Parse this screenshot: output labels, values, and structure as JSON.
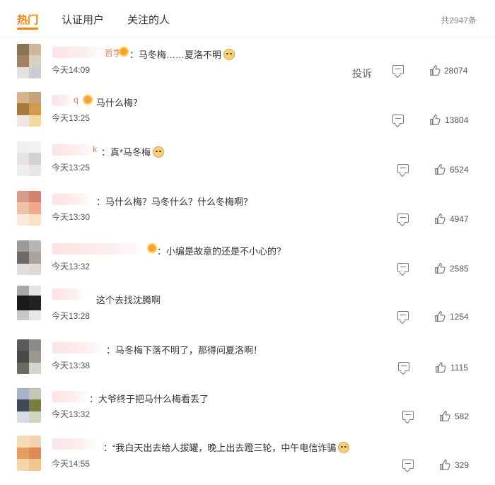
{
  "tabs": [
    "热门",
    "认证用户",
    "关注的人"
  ],
  "total": "共2947条",
  "report_label": "投诉",
  "colors": {
    "accent": "#ff8200",
    "text": "#333333",
    "muted": "#888888"
  },
  "comments": [
    {
      "text": "：马冬梅……夏洛不明",
      "time": "今天14:09",
      "likes": "28074",
      "name_visible": "哲学",
      "emoji": "dog-icon"
    },
    {
      "text": "马什么梅？",
      "time": "今天13:25",
      "likes": "13804",
      "name_visible": "q",
      "emoji": ""
    },
    {
      "text": "：真*马冬梅",
      "time": "今天13:25",
      "likes": "6524",
      "name_visible": "k",
      "emoji": "dog-icon"
    },
    {
      "text": "：马什么梅？马冬什么？什么冬梅啊？",
      "time": "今天13:30",
      "likes": "4947",
      "name_visible": "",
      "emoji": ""
    },
    {
      "text": "：小编是故意的还是不小心的？",
      "time": "今天13:32",
      "likes": "2585",
      "name_visible": "",
      "emoji": ""
    },
    {
      "text": "这个去找沈腾啊",
      "time": "今天13:28",
      "likes": "1254",
      "name_visible": "",
      "emoji": ""
    },
    {
      "text": "：马冬梅下落不明了，那得问夏洛啊！",
      "time": "今天13:38",
      "likes": "1115",
      "name_visible": "",
      "emoji": ""
    },
    {
      "text": "：大爷终于把马什么梅看丢了",
      "time": "今天13:32",
      "likes": "582",
      "name_visible": "",
      "emoji": ""
    },
    {
      "text": "：“我白天出去给人拔罐，晚上出去蹬三轮，中午电信诈骗",
      "time": "今天14:55",
      "likes": "329",
      "name_visible": "",
      "emoji": "dog-icon"
    }
  ]
}
